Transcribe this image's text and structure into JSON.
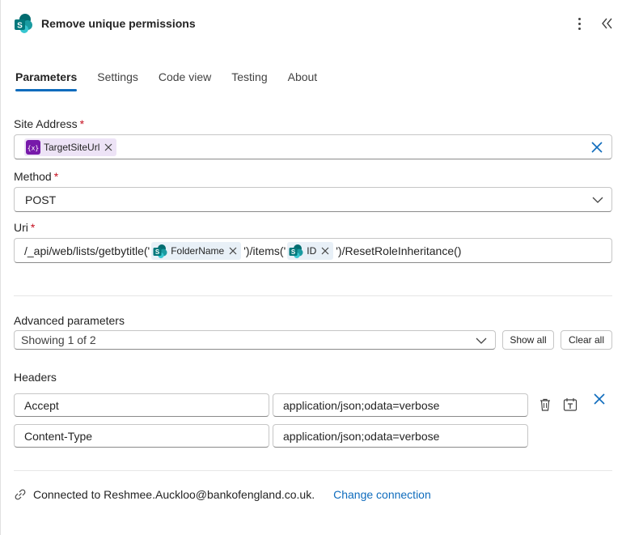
{
  "header": {
    "title": "Remove unique permissions",
    "more_icon": "more-vertical-icon",
    "collapse_icon": "double-chevron-left-icon",
    "logo": "sharepoint-logo"
  },
  "tabs": [
    {
      "label": "Parameters",
      "active": true
    },
    {
      "label": "Settings",
      "active": false
    },
    {
      "label": "Code view",
      "active": false
    },
    {
      "label": "Testing",
      "active": false
    },
    {
      "label": "About",
      "active": false
    }
  ],
  "site_address": {
    "label": "Site Address",
    "required_mark": "*",
    "token": {
      "label": "TargetSiteUrl",
      "icon": "variable-icon"
    }
  },
  "method": {
    "label": "Method",
    "required_mark": "*",
    "value": "POST"
  },
  "uri": {
    "label": "Uri",
    "required_mark": "*",
    "text_1": "/_api/web/lists/getbytitle('",
    "token_1": {
      "label": "FolderName",
      "icon": "sharepoint-icon"
    },
    "text_2": "')/items('",
    "token_2": {
      "label": "ID",
      "icon": "sharepoint-icon"
    },
    "text_3": "')/ResetRoleInheritance()"
  },
  "advanced": {
    "label": "Advanced parameters",
    "select_value": "Showing 1 of 2",
    "show_all": "Show all",
    "clear_all": "Clear all"
  },
  "headers": {
    "label": "Headers",
    "rows": [
      {
        "key": "Accept",
        "value": "application/json;odata=verbose"
      },
      {
        "key": "Content-Type",
        "value": "application/json;odata=verbose"
      }
    ]
  },
  "connection": {
    "text": "Connected to Reshmee.Auckloo@bankofengland.co.uk.",
    "change_label": "Change connection",
    "icon": "link-icon"
  },
  "colors": {
    "accent": "#0f6cbd",
    "required": "#c50f1f",
    "variable_token_bg": "#ede3f6",
    "variable_icon": "#7719aa",
    "sharepoint": "#038387"
  }
}
